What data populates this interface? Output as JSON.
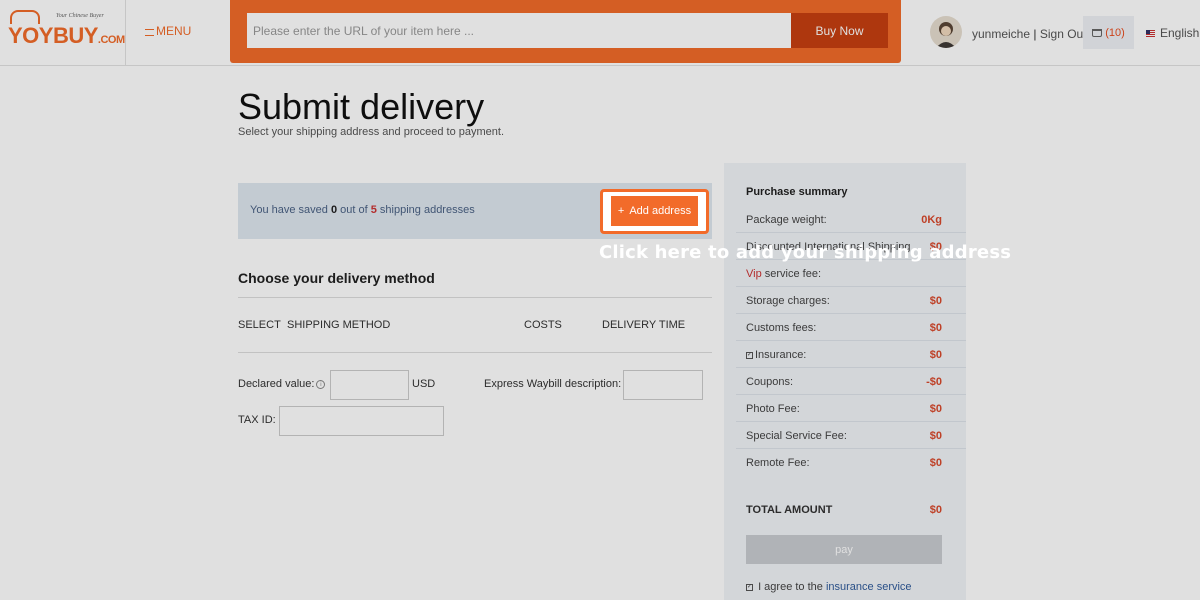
{
  "header": {
    "logo_text": "YOYBUY",
    "logo_suffix": ".COM",
    "logo_tagline": "Your Chinese Buyer",
    "menu_label": "MENU",
    "search_placeholder": "Please enter the URL of your item here ...",
    "buy_label": "Buy Now",
    "username": "yunmeiche",
    "separator": "|",
    "sign_out": "Sign Out",
    "cart_count": "(10)",
    "language": "English"
  },
  "main": {
    "title": "Submit delivery",
    "subtitle": "Select your shipping address and proceed to payment.",
    "saved_prefix": "You have saved",
    "saved_count": "0",
    "saved_middle": "out of",
    "saved_max": "5",
    "saved_suffix": "shipping addresses",
    "add_address_icon": "+",
    "add_address_label": "Add address",
    "delivery_title": "Choose your delivery method",
    "columns": {
      "select": "SELECT",
      "method": "SHIPPING METHOD",
      "costs": "COSTS",
      "delivery_time": "DELIVERY TIME"
    },
    "declared_label": "Declared value:",
    "declared_unit": "USD",
    "waybill_label": "Express Waybill description:",
    "tax_label": "TAX ID:"
  },
  "summary": {
    "title": "Purchase summary",
    "rows": [
      {
        "label": "Package weight:",
        "value": "0Kg"
      },
      {
        "label": "Discounted International Shipping",
        "value": "$0"
      },
      {
        "label_vip": "Vip",
        "label": "service fee:",
        "value": ""
      },
      {
        "label": "Storage charges:",
        "value": "$0"
      },
      {
        "label": "Customs fees:",
        "value": "$0"
      },
      {
        "label": "Insurance:",
        "value": "$0"
      },
      {
        "label": "Coupons:",
        "value": "-$0"
      },
      {
        "label": "Photo Fee:",
        "value": "$0"
      },
      {
        "label": "Special Service Fee:",
        "value": "$0"
      },
      {
        "label": "Remote Fee:",
        "value": "$0"
      }
    ],
    "total_label": "TOTAL AMOUNT",
    "total_value": "$0",
    "pay_label": "pay",
    "agree_text": "I agree to the",
    "agree_link": "insurance service"
  },
  "overlay": {
    "hint": "Click here to add your shipping address"
  },
  "colors": {
    "brand": "#f26b2a",
    "buy_button": "#c63f10",
    "price_red": "#d9492c",
    "panel_bg": "#f1f4f8"
  }
}
